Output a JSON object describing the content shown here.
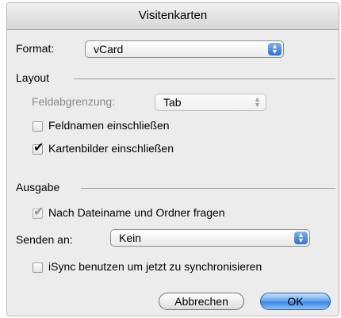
{
  "window": {
    "title": "Visitenkarten"
  },
  "format": {
    "label": "Format:",
    "value": "vCard"
  },
  "layout": {
    "heading": "Layout",
    "field_delimiter": {
      "label": "Feldabgrenzung:",
      "value": "Tab",
      "enabled": false
    },
    "include_field_names": {
      "label": "Feldnamen einschließen",
      "checked": false
    },
    "include_card_images": {
      "label": "Kartenbilder einschließen",
      "checked": true
    }
  },
  "output": {
    "heading": "Ausgabe",
    "ask_filename": {
      "label": "Nach Dateiname und Ordner fragen",
      "checked": true,
      "enabled": false
    },
    "send_to": {
      "label": "Senden an:",
      "value": "Kein"
    },
    "isync": {
      "label": "iSync benutzen um jetzt zu synchronisieren",
      "checked": false
    }
  },
  "buttons": {
    "cancel": "Abbrechen",
    "ok": "OK"
  },
  "icons": {
    "check": "✔",
    "stepper": "▲▼"
  },
  "colors": {
    "accent": "#3d86e2",
    "window_bg": "#ececec"
  }
}
